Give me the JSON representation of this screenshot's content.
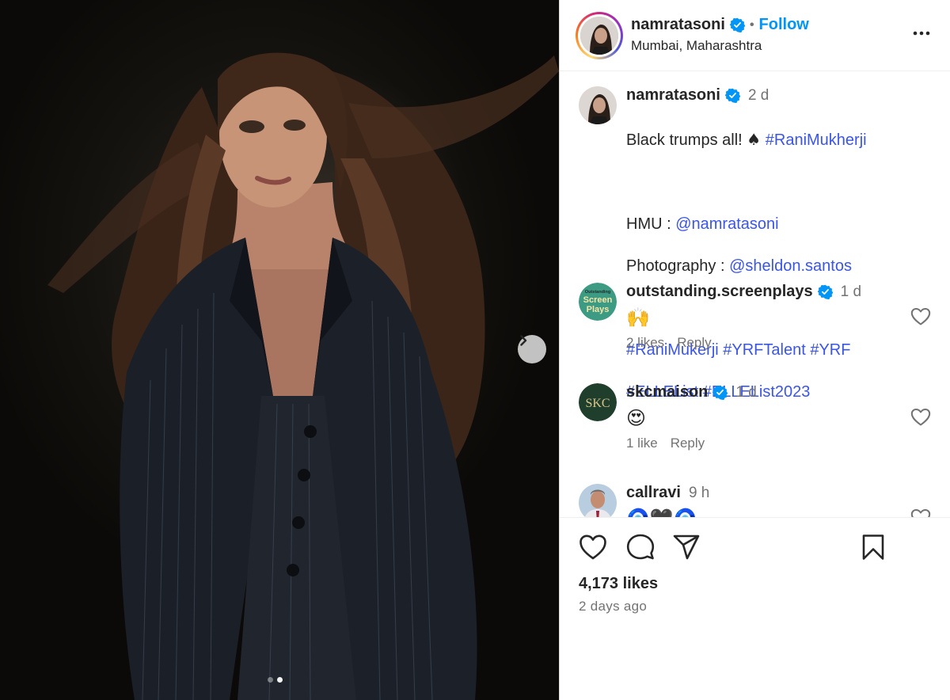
{
  "post": {
    "author": "namratasoni",
    "location": "Mumbai, Maharashtra",
    "follow_label": "Follow",
    "separator": "•",
    "carousel": {
      "total_slides": 2,
      "current_slide": 2
    }
  },
  "caption": {
    "username": "namratasoni",
    "time": "2 d",
    "line1_text": "Black trumps all! ",
    "line1_emoji": "♠",
    "line1_tag": "#RaniMukherji",
    "hmu_label": "HMU : ",
    "hmu_handle": "@namratasoni",
    "photo_label": "Photography : ",
    "photo_handle": "@sheldon.santos",
    "tags_line1": "#RaniMukerji #YRFTalent #YRF",
    "tags_line2": "#ELLEList #ELLEList2023"
  },
  "comments": [
    {
      "username": "outstanding.screenplays",
      "verified": true,
      "time": "1 d",
      "text": "🙌",
      "likes": "2 likes",
      "reply": "Reply",
      "avatar_text": [
        "Outstanding",
        "Screen",
        "Plays"
      ]
    },
    {
      "username": "skcmaison",
      "verified": true,
      "time": "1 d",
      "text": "😍",
      "likes": "1 like",
      "reply": "Reply",
      "avatar_text": [
        "SKC"
      ]
    },
    {
      "username": "callravi",
      "verified": false,
      "time": "9 h",
      "text": "🧿🖤🧿"
    }
  ],
  "footer": {
    "likes": "4,173 likes",
    "posted": "2 days ago"
  },
  "colors": {
    "link_blue": "#3b55e6",
    "follow_blue": "#0095f6",
    "verified_blue": "#0095f6",
    "muted": "#737373"
  }
}
